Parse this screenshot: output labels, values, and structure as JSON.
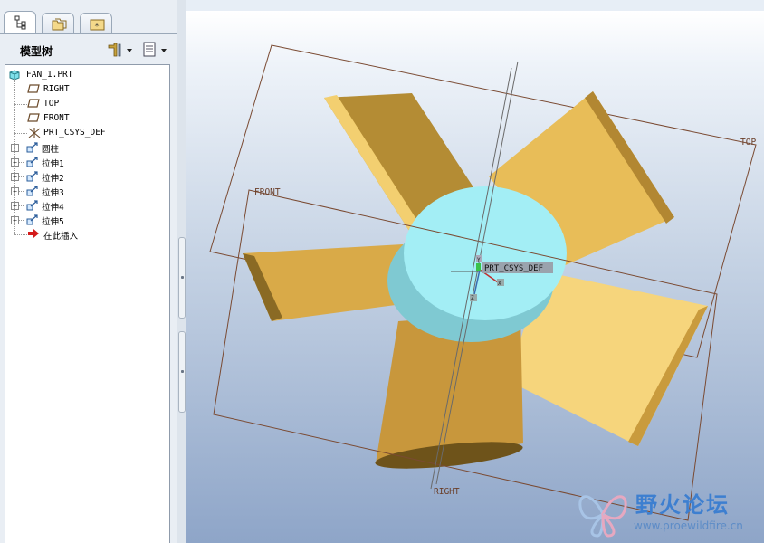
{
  "panel": {
    "title": "模型树",
    "tabs": [
      {
        "icon": "model-tree-icon",
        "active": true
      },
      {
        "icon": "folder-browser-icon",
        "active": false
      },
      {
        "icon": "favorites-icon",
        "active": false
      }
    ],
    "buttons": {
      "settings_icon": "tree-settings-icon",
      "show_icon": "tree-show-icon"
    }
  },
  "tree": {
    "root": "FAN_1.PRT",
    "items": [
      {
        "label": "RIGHT",
        "icon": "datum-plane-icon",
        "expandable": false
      },
      {
        "label": "TOP",
        "icon": "datum-plane-icon",
        "expandable": false
      },
      {
        "label": "FRONT",
        "icon": "datum-plane-icon",
        "expandable": false
      },
      {
        "label": "PRT_CSYS_DEF",
        "icon": "coordinate-system-icon",
        "expandable": false
      },
      {
        "label": "圆柱",
        "icon": "extrude-icon",
        "expandable": true
      },
      {
        "label": "拉伸1",
        "icon": "extrude-icon",
        "expandable": true
      },
      {
        "label": "拉伸2",
        "icon": "extrude-icon",
        "expandable": true
      },
      {
        "label": "拉伸3",
        "icon": "extrude-icon",
        "expandable": true
      },
      {
        "label": "拉伸4",
        "icon": "extrude-icon",
        "expandable": true
      },
      {
        "label": "拉伸5",
        "icon": "extrude-icon",
        "expandable": true
      },
      {
        "label": "在此插入",
        "icon": "insert-here-arrow-icon",
        "expandable": false
      }
    ]
  },
  "viewport": {
    "datum_labels": {
      "top": "TOP",
      "front": "FRONT",
      "right": "RIGHT",
      "csys": "PRT_CSYS_DEF",
      "axis_x": "X",
      "axis_y": "Y",
      "axis_z": "Z"
    },
    "colors": {
      "blade": "#e3b85a",
      "hub_top": "#a3eef5",
      "hub_side": "#7fc9d2",
      "datum": "#7a4a32"
    }
  },
  "watermark": {
    "name": "野火论坛",
    "url": "www.proewildfire.cn"
  }
}
